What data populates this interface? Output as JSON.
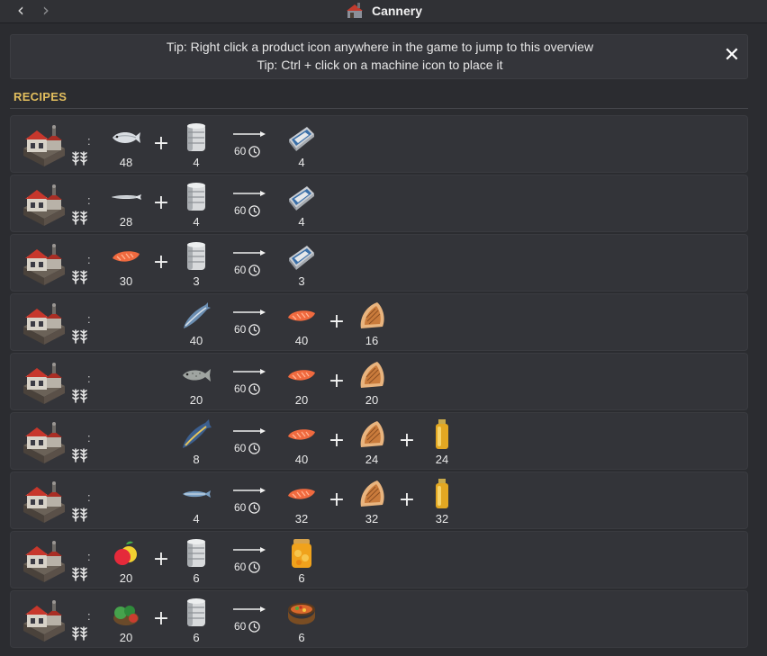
{
  "window": {
    "title": "Cannery",
    "title_icon": "cannery-building-icon",
    "back_icon": "chevron-left-icon",
    "forward_icon": "chevron-right-icon"
  },
  "tips": {
    "line1": "Tip: Right click a product icon anywhere in the game to jump to this overview",
    "line2": "Tip: Ctrl + click on a machine icon to place it",
    "close_icon": "close-icon",
    "close_glyph": "✕"
  },
  "section": {
    "title": "RECIPES"
  },
  "glyphs": {
    "plus": "+"
  },
  "recipes": [
    {
      "duration": "60",
      "inputs": [
        {
          "icon": "herring-icon",
          "qty": "48"
        },
        {
          "icon": "tin-can-icon",
          "qty": "4"
        }
      ],
      "outputs": [
        {
          "icon": "canned-fish-icon",
          "qty": "4"
        }
      ]
    },
    {
      "duration": "60",
      "inputs": [
        {
          "icon": "anchovy-icon",
          "qty": "28"
        },
        {
          "icon": "tin-can-icon",
          "qty": "4"
        }
      ],
      "outputs": [
        {
          "icon": "canned-fish-icon",
          "qty": "4"
        }
      ]
    },
    {
      "duration": "60",
      "inputs": [
        {
          "icon": "fish-fillet-icon",
          "qty": "30"
        },
        {
          "icon": "tin-can-icon",
          "qty": "3"
        }
      ],
      "outputs": [
        {
          "icon": "canned-fish-icon",
          "qty": "3"
        }
      ]
    },
    {
      "duration": "60",
      "inputs": [
        {
          "icon": "mackerel-icon",
          "qty": "40"
        }
      ],
      "outputs": [
        {
          "icon": "fish-fillet-icon",
          "qty": "40"
        },
        {
          "icon": "fish-skin-icon",
          "qty": "16"
        }
      ]
    },
    {
      "duration": "60",
      "inputs": [
        {
          "icon": "cod-icon",
          "qty": "20"
        }
      ],
      "outputs": [
        {
          "icon": "fish-fillet-icon",
          "qty": "20"
        },
        {
          "icon": "fish-skin-icon",
          "qty": "20"
        }
      ]
    },
    {
      "duration": "60",
      "inputs": [
        {
          "icon": "tuna-icon",
          "qty": "8"
        }
      ],
      "outputs": [
        {
          "icon": "fish-fillet-icon",
          "qty": "40"
        },
        {
          "icon": "fish-skin-icon",
          "qty": "24"
        },
        {
          "icon": "fish-oil-icon",
          "qty": "24"
        }
      ]
    },
    {
      "duration": "60",
      "inputs": [
        {
          "icon": "sardine-icon",
          "qty": "4"
        }
      ],
      "outputs": [
        {
          "icon": "fish-fillet-icon",
          "qty": "32"
        },
        {
          "icon": "fish-skin-icon",
          "qty": "32"
        },
        {
          "icon": "fish-oil-icon",
          "qty": "32"
        }
      ]
    },
    {
      "duration": "60",
      "inputs": [
        {
          "icon": "fruit-icon",
          "qty": "20"
        },
        {
          "icon": "tin-can-icon",
          "qty": "6"
        }
      ],
      "outputs": [
        {
          "icon": "preserved-fruit-jar-icon",
          "qty": "6"
        }
      ]
    },
    {
      "duration": "60",
      "inputs": [
        {
          "icon": "vegetables-icon",
          "qty": "20"
        },
        {
          "icon": "tin-can-icon",
          "qty": "6"
        }
      ],
      "outputs": [
        {
          "icon": "stew-pot-icon",
          "qty": "6"
        }
      ]
    }
  ],
  "colors": {
    "background": "#2b2c30",
    "row": "#333439",
    "section_title": "#e3bf5e",
    "text": "#e8e8e8"
  }
}
